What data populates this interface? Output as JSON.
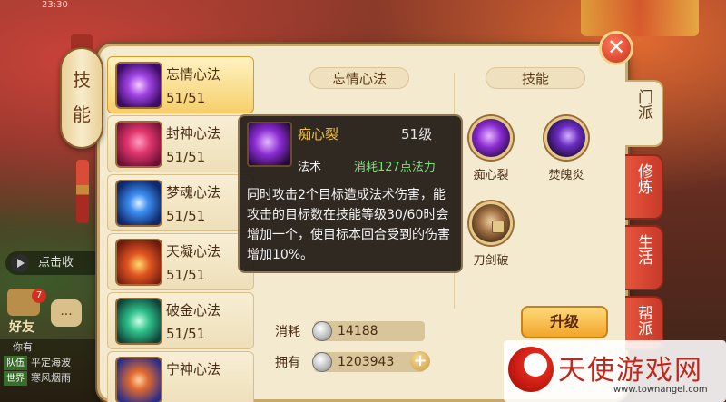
{
  "status": {
    "clock": "23:30"
  },
  "left_hud": {
    "chat_button": "点击收",
    "friend_badge": "7",
    "friend_label": "好友",
    "msg_icon": "...",
    "chat_rows": [
      {
        "tag": "",
        "text": "你有"
      },
      {
        "tag": "队伍",
        "text": "平定海波"
      },
      {
        "tag": "世界",
        "text": "寒风烟雨"
      }
    ]
  },
  "banner": {
    "chars": [
      "技",
      "能"
    ]
  },
  "close_label": "✕",
  "skill_list": [
    {
      "name": "忘情心法",
      "level": "51/51",
      "selected": true
    },
    {
      "name": "封神心法",
      "level": "51/51"
    },
    {
      "name": "梦魂心法",
      "level": "51/51"
    },
    {
      "name": "天凝心法",
      "level": "51/51"
    },
    {
      "name": "破金心法",
      "level": "51/51"
    },
    {
      "name": "宁神心法",
      "level": ""
    }
  ],
  "detail": {
    "left_header": "忘情心法",
    "right_header": "技能",
    "skills": [
      {
        "name": "痴心裂",
        "icon": "purple-lightning-icon"
      },
      {
        "name": "焚魄炎",
        "icon": "dark-vortex-icon"
      },
      {
        "name": "刀剑破",
        "icon": "locked-blade-icon"
      }
    ],
    "cost_label": "消耗",
    "cost_value": "14188",
    "own_label": "拥有",
    "own_value": "1203943",
    "plus": "+",
    "upgrade_button": "升级"
  },
  "tabs": [
    {
      "label": "门派",
      "active": true
    },
    {
      "label": "修炼",
      "active": false
    },
    {
      "label": "生活",
      "active": false
    },
    {
      "label": "帮派",
      "active": false
    }
  ],
  "tooltip": {
    "name": "痴心裂",
    "level": "51级",
    "type": "法术",
    "cost": "消耗127点法力",
    "description": "同时攻击2个目标造成法术伤害，能攻击的目标数在技能等级30/60时会增加一个，使目标本回合受到的伤害增加10%。"
  },
  "watermark": {
    "text": "天使游戏网",
    "url": "www.townangel.com"
  },
  "colors": {
    "accent": "#f1a62b",
    "tooltip_name": "#f6c037",
    "tooltip_cost": "#7fe07a"
  }
}
